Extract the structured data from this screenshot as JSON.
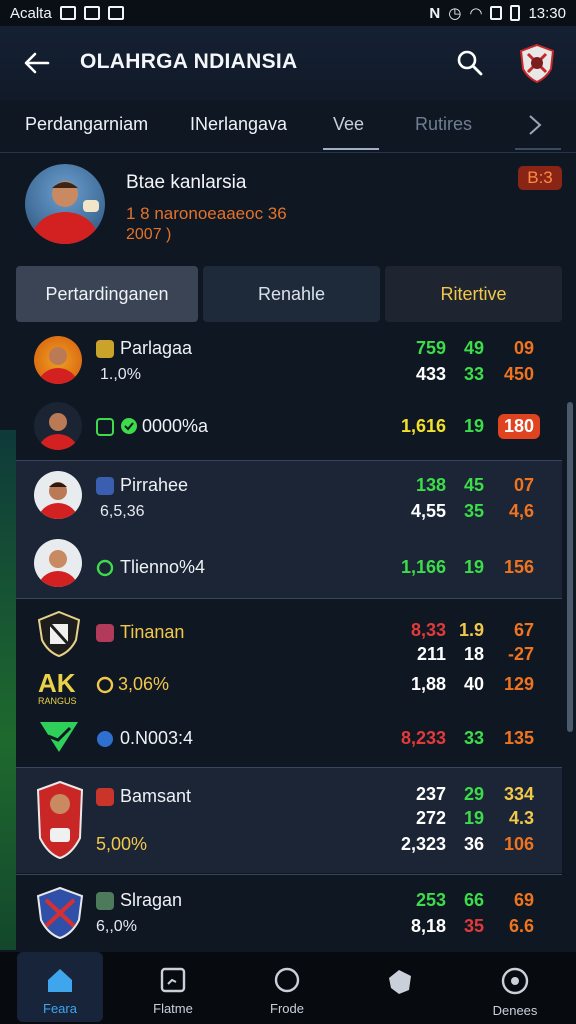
{
  "status": {
    "carrier": "Acalta",
    "time": "13:30"
  },
  "appbar": {
    "title": "OLAHRGA NDIANSIA"
  },
  "tabs": [
    "Perdangarniam",
    "INerlangava",
    "Vee",
    "Rutires"
  ],
  "profile": {
    "name": "Btae kanlarsia",
    "line1": "1 8  naronoeaaeoc  36",
    "line2": "2007 )",
    "badge": "B:3"
  },
  "segments": [
    "Pertardinganen",
    "Renahle",
    "Ritertive"
  ],
  "rows": [
    {
      "name": "Parlagaa",
      "sub": "1.,0%",
      "v1a": "759",
      "v2a": "49",
      "v3a": "09",
      "v1b": "433",
      "v2b": "33",
      "v3b": "450"
    },
    {
      "name": "0000%a",
      "sub": "",
      "v1a": "1,616",
      "v2a": "19",
      "v3a": "180"
    },
    {
      "name": "Pirrahee",
      "sub": "6,5,36",
      "v1a": "138",
      "v2a": "45",
      "v3a": "07",
      "v1b": "4,55",
      "v2b": "35",
      "v3b": "4,6"
    },
    {
      "name": "Tlienno%4",
      "sub": "",
      "v1a": "1,166",
      "v2a": "19",
      "v3a": "156"
    },
    {
      "name": "Tinanan",
      "sub": "",
      "v1a": "8,33",
      "v2a": "1.9",
      "v3a": "67",
      "v1b": "211",
      "v2b": "18",
      "v3b": "-27"
    },
    {
      "name": "3,06%",
      "sub": "",
      "v1a": "1,88",
      "v2a": "40",
      "v3a": "129",
      "logo_text": "AK",
      "logo_sub": "RANGUS"
    },
    {
      "name": "0.N003:4",
      "sub": "",
      "v1a": "8,233",
      "v2a": "33",
      "v3a": "135"
    },
    {
      "name": "Bamsant",
      "sub": "5,00%",
      "v1a": "237",
      "v2a": "29",
      "v3a": "334",
      "v1b": "272",
      "v2b": "19",
      "v3b": "4.3",
      "v1c": "2,323",
      "v2c": "36",
      "v3c": "106"
    },
    {
      "name": "Slragan",
      "sub": "6,,0%",
      "v1a": "253",
      "v2a": "66",
      "v3a": "69",
      "v1b": "8,18",
      "v2b": "35",
      "v3b": "6.6"
    }
  ],
  "nav": [
    "Feara",
    "Flatme",
    "Frode",
    "",
    "Denees"
  ],
  "icons": [
    "back-arrow-icon",
    "search-icon",
    "club-crest-icon",
    "chevron-right-icon",
    "home-icon",
    "match-icon",
    "circle-icon",
    "bag-icon",
    "ball-icon"
  ],
  "colors": {
    "accent": "#3fa6ee",
    "green": "#3ddc4a",
    "orange": "#f0741f",
    "red": "#e23a3a",
    "yellow": "#f2c84b"
  }
}
